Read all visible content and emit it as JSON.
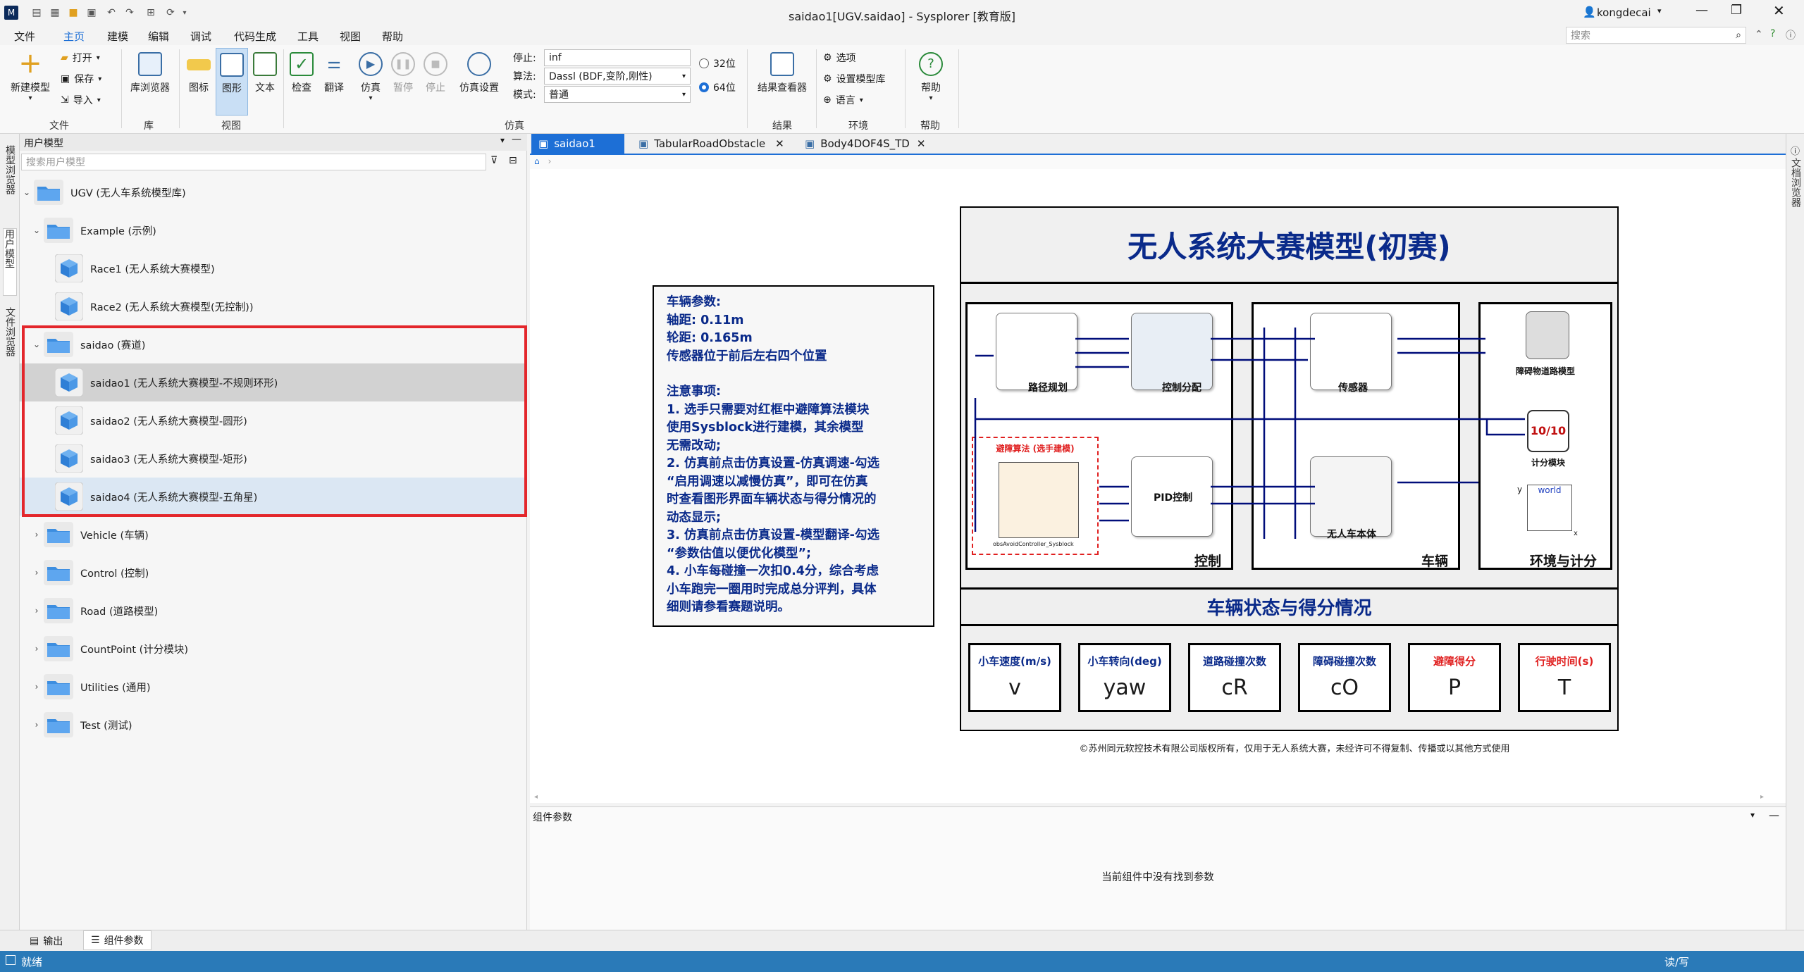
{
  "window": {
    "title": "saidao1[UGV.saidao] - Sysplorer [教育版]",
    "user": "kongdecai",
    "search_placeholder": "搜索"
  },
  "menu": [
    "文件",
    "主页",
    "建模",
    "编辑",
    "调试",
    "代码生成",
    "工具",
    "视图",
    "帮助"
  ],
  "ribbon": {
    "new_model": "新建模型",
    "open": "打开",
    "save": "保存",
    "import": "导入",
    "library_browser": "库浏览器",
    "icon": "图标",
    "diagram": "图形",
    "text": "文本",
    "check": "检查",
    "translate": "翻译",
    "simulate": "仿真",
    "pause": "暂停",
    "stop": "停止",
    "sim_settings": "仿真设置",
    "stop_label": "停止:",
    "stop_value": "inf",
    "algo_label": "算法:",
    "algo_value": "Dassl (BDF,变阶,刚性)",
    "mode_label": "模式:",
    "mode_value": "普通",
    "bit32": "32位",
    "bit64": "64位",
    "result_viewer": "结果查看器",
    "options": "选项",
    "set_lib": "设置模型库",
    "language": "语言",
    "help": "帮助",
    "groups": {
      "file": "文件",
      "lib": "库",
      "view": "视图",
      "sim": "仿真",
      "result": "结果",
      "env": "环境",
      "help": "帮助"
    }
  },
  "left_strip": [
    "模型浏览器",
    "用户模型",
    "文件浏览器"
  ],
  "tree": {
    "header": "用户模型",
    "search_placeholder": "搜索用户模型",
    "items": [
      {
        "label": "UGV (无人车系统模型库)",
        "level": 0,
        "kind": "folder"
      },
      {
        "label": "Example (示例)",
        "level": 1,
        "kind": "folder"
      },
      {
        "label": "Race1 (无人系统大赛模型)",
        "level": 2,
        "kind": "model"
      },
      {
        "label": "Race2 (无人系统大赛模型(无控制))",
        "level": 2,
        "kind": "model"
      },
      {
        "label": "saidao (赛道)",
        "level": 1,
        "kind": "folder"
      },
      {
        "label": "saidao1 (无人系统大赛模型-不规则环形)",
        "level": 2,
        "kind": "model"
      },
      {
        "label": "saidao2 (无人系统大赛模型-圆形)",
        "level": 2,
        "kind": "model"
      },
      {
        "label": "saidao3 (无人系统大赛模型-矩形)",
        "level": 2,
        "kind": "model"
      },
      {
        "label": "saidao4 (无人系统大赛模型-五角星)",
        "level": 2,
        "kind": "model"
      },
      {
        "label": "Vehicle (车辆)",
        "level": 1,
        "kind": "folder"
      },
      {
        "label": "Control (控制)",
        "level": 1,
        "kind": "folder"
      },
      {
        "label": "Road (道路模型)",
        "level": 1,
        "kind": "folder"
      },
      {
        "label": "CountPoint (计分模块)",
        "level": 1,
        "kind": "folder"
      },
      {
        "label": "Utilities (通用)",
        "level": 1,
        "kind": "folder"
      },
      {
        "label": "Test (测试)",
        "level": 1,
        "kind": "folder"
      }
    ]
  },
  "tabs": [
    "saidao1",
    "TabularRoadObstacle",
    "Body4DOF4S_TD"
  ],
  "right_strip": "文档浏览器",
  "diagram": {
    "title": "无人系统大赛模型(初赛)",
    "notes": [
      "车辆参数:",
      "轴距: 0.11m",
      "轮距: 0.165m",
      "传感器位于前后左右四个位置",
      "",
      "注意事项:",
      "1. 选手只需要对红框中避障算法模块",
      "使用Sysblock进行建模，其余模型",
      "无需改动;",
      "2. 仿真前点击仿真设置-仿真调速-勾选",
      "“启用调速以减慢仿真”，即可在仿真",
      "时查看图形界面车辆状态与得分情况的",
      "动态显示;",
      "3. 仿真前点击仿真设置-模型翻译-勾选",
      "“参数估值以便优化模型”;",
      "4. 小车每碰撞一次扣0.4分，综合考虑",
      "小车跑完一圈用时完成总分评判，具体",
      "细则请参看赛题说明。"
    ],
    "blocks": {
      "path": "路径规划",
      "dist": "控制分配",
      "sensor": "传感器",
      "obstacle_road": "障碍物道路模型",
      "avoid": "避障算法 (选手建模)",
      "sysblock": "obsAvoidController_Sysblock",
      "pid": "PID控制",
      "body": "无人车本体",
      "score": "计分模块",
      "world": "world",
      "axis_y": "y",
      "axis_x": "x",
      "score_icon": "10/10"
    },
    "sections": {
      "control": "控制",
      "vehicle": "车辆",
      "env": "环境与计分"
    },
    "status_title": "车辆状态与得分情况",
    "cards": [
      {
        "label": "小车速度(m/s)",
        "value": "v",
        "color": "#0a2a8a"
      },
      {
        "label": "小车转向(deg)",
        "value": "yaw",
        "color": "#0a2a8a"
      },
      {
        "label": "道路碰撞次数",
        "value": "cR",
        "color": "#0a2a8a"
      },
      {
        "label": "障碍碰撞次数",
        "value": "cO",
        "color": "#0a2a8a"
      },
      {
        "label": "避障得分",
        "value": "P",
        "color": "#e02020"
      },
      {
        "label": "行驶时间(s)",
        "value": "T",
        "color": "#e02020"
      }
    ],
    "copyright": "©苏州同元软控技术有限公司版权所有，仅用于无人系统大赛，未经许可不得复制、传播或以其他方式使用"
  },
  "params": {
    "header": "组件参数",
    "empty": "当前组件中没有找到参数"
  },
  "bottom_tabs": [
    "输出",
    "组件参数"
  ],
  "status": {
    "left": "就绪",
    "right": "读/写"
  },
  "colors": {
    "accent": "#1d6fd6",
    "highlight_red": "#e3262b",
    "diagram_blue": "#0a2a8a",
    "status_bar": "#2a7ab8"
  }
}
